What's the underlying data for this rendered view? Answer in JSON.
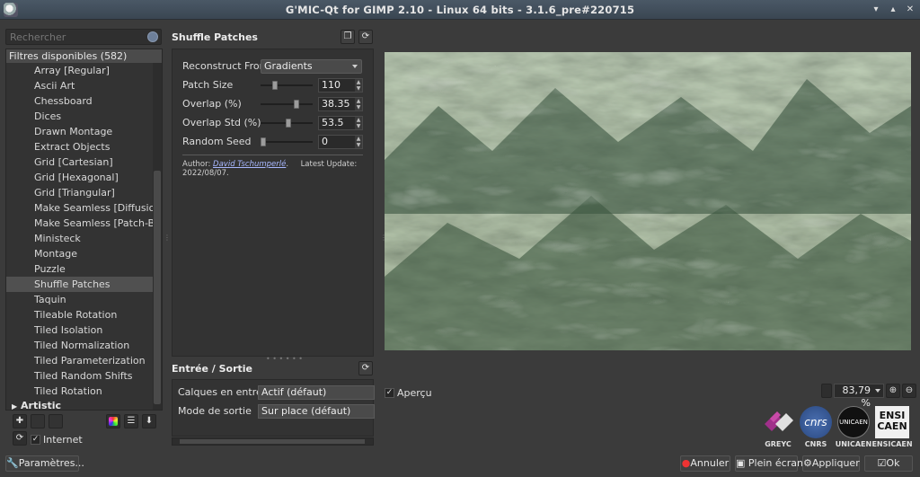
{
  "window": {
    "title": "G'MIC-Qt for GIMP 2.10 - Linux 64 bits - 3.1.6_pre#220715"
  },
  "search": {
    "placeholder": "Rechercher"
  },
  "filters": {
    "header": "Filtres disponibles (582)",
    "items": [
      "Array [Regular]",
      "Ascii Art",
      "Chessboard",
      "Dices",
      "Drawn Montage",
      "Extract Objects",
      "Grid [Cartesian]",
      "Grid [Hexagonal]",
      "Grid [Triangular]",
      "Make Seamless [Diffusion]",
      "Make Seamless [Patch-Based]",
      "Ministeck",
      "Montage",
      "Puzzle",
      "Shuffle Patches",
      "Taquin",
      "Tileable Rotation",
      "Tiled Isolation",
      "Tiled Normalization",
      "Tiled Parameterization",
      "Tiled Random Shifts",
      "Tiled Rotation"
    ],
    "selected_index": 14,
    "next_category": "Artistic"
  },
  "internet": {
    "label": "Internet",
    "checked": true
  },
  "buttons": {
    "settings": "Paramètres...",
    "cancel": "Annuler",
    "fullscreen": "Plein écran",
    "apply": "Appliquer",
    "ok": "Ok"
  },
  "filter": {
    "title": "Shuffle Patches",
    "params": {
      "reconstruct": {
        "label": "Reconstruct From",
        "value": "Gradients"
      },
      "patch_size": {
        "label": "Patch Size",
        "value": "110",
        "fraction": 0.25
      },
      "overlap": {
        "label": "Overlap (%)",
        "value": "38.35",
        "fraction": 0.72
      },
      "overlap_std": {
        "label": "Overlap Std (%)",
        "value": "53.5",
        "fraction": 0.53
      },
      "random_seed": {
        "label": "Random Seed",
        "value": "0",
        "fraction": 0.0
      }
    },
    "author_label": "Author:",
    "author_name": "David Tschumperlé",
    "update_label": "Latest Update:",
    "update_date": "2022/08/07."
  },
  "io": {
    "title": "Entrée / Sortie",
    "input_label": "Calques en entrée",
    "input_value": "Actif (défaut)",
    "output_label": "Mode de sortie",
    "output_value": "Sur place (défaut)"
  },
  "preview": {
    "apercu_label": "Aperçu",
    "apercu_checked": true,
    "zoom": "83,79 %"
  },
  "logos": {
    "greyc": "GREYC",
    "cnrs": "CNRS",
    "unicaen": "UNICAEN",
    "ensicaen": "ENSICAEN",
    "cnrs_mark": "cnrs",
    "unicaen_mark": "UNICAEN",
    "ensicaen_mark_1": "ENSI",
    "ensicaen_mark_2": "CAEN"
  }
}
